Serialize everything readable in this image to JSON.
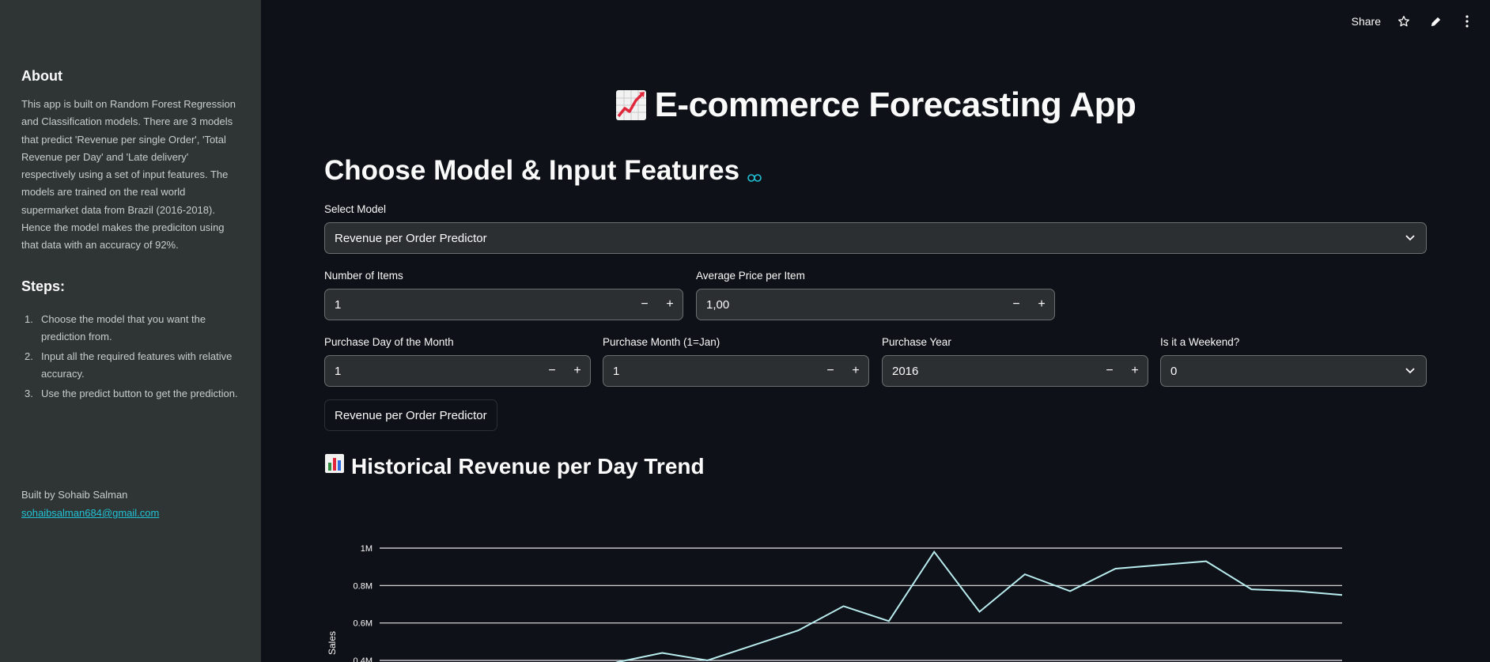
{
  "sidebar": {
    "about_title": "About",
    "about_text": "This app is built on Random Forest Regression and Classification models. There are 3 models that predict 'Revenue per single Order', 'Total Revenue per Day' and 'Late delivery' respectively using a set of input features. The models are trained on the real world supermarket data from Brazil (2016-2018). Hence the model makes the prediciton using that data with an accuracy of 92%.",
    "steps_title": "Steps:",
    "steps": [
      {
        "num": "1.",
        "text": "Choose the model that you want the prediction from."
      },
      {
        "num": "2.",
        "text": "Input all the required features with relative accuracy."
      },
      {
        "num": "3.",
        "text": "Use the predict button to get the prediction."
      }
    ],
    "built_by": "Built by Sohaib Salman",
    "email": "sohaibsalman684@gmail.com"
  },
  "topbar": {
    "share_label": "Share",
    "icons": [
      "star-icon",
      "pencil-icon",
      "more-vertical-icon"
    ]
  },
  "main": {
    "app_title": "E-commerce Forecasting App",
    "app_title_icon": "chart-increasing-icon",
    "section_title": "Choose Model & Input Features",
    "model_select": {
      "label": "Select Model",
      "value": "Revenue per Order Predictor"
    },
    "num_items": {
      "label": "Number of Items",
      "value": "1",
      "minus": "−",
      "plus": "+"
    },
    "avg_price": {
      "label": "Average Price per Item",
      "value": "1,00",
      "minus": "−",
      "plus": "+"
    },
    "purchase_day": {
      "label": "Purchase Day of the Month",
      "value": "1",
      "minus": "−",
      "plus": "+"
    },
    "purchase_month": {
      "label": "Purchase Month (1=Jan)",
      "value": "1",
      "minus": "−",
      "plus": "+"
    },
    "purchase_year": {
      "label": "Purchase Year",
      "value": "2016",
      "minus": "−",
      "plus": "+"
    },
    "weekend": {
      "label": "Is it a Weekend?",
      "value": "0"
    },
    "predict_button": "Revenue per Order Predictor",
    "chart_title": "Historical Revenue per Day Trend",
    "chart_title_icon": "bar-chart-icon"
  },
  "colors": {
    "background": "#0e1117",
    "sidebar": "#2f3535",
    "accent_link": "#21c2d6",
    "line": "#b8ecef"
  },
  "chart_data": {
    "type": "line",
    "ylabel": "Sales",
    "yticks": [
      "0.4M",
      "0.6M",
      "0.8M",
      "1M"
    ],
    "ytick_values": [
      400000,
      600000,
      800000,
      1000000
    ],
    "ylim": [
      350000,
      1050000
    ],
    "grid": true,
    "series": [
      {
        "values": [
          390000,
          440000,
          400000,
          480000,
          560000,
          690000,
          610000,
          980000,
          660000,
          860000,
          770000,
          890000,
          910000,
          930000,
          780000,
          770000,
          750000
        ]
      }
    ]
  }
}
